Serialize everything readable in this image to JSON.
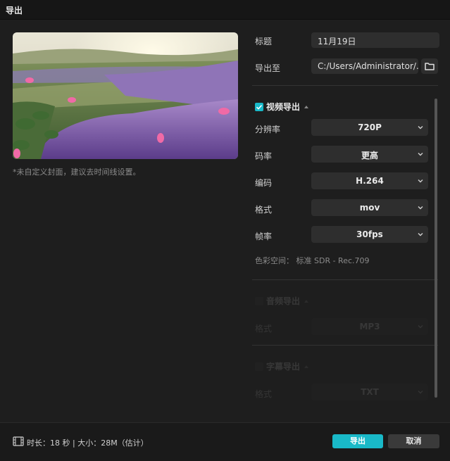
{
  "window": {
    "title": "导出"
  },
  "preview": {
    "cover_note": "*未自定义封面，建议去时间线设置。"
  },
  "form": {
    "title_label": "标题",
    "title_value": "11月19日",
    "export_to_label": "导出至",
    "export_to_value": "C:/Users/Administrator/..."
  },
  "video_export": {
    "label": "视频导出",
    "checked": true,
    "resolution_label": "分辨率",
    "resolution_value": "720P",
    "bitrate_label": "码率",
    "bitrate_value": "更高",
    "codec_label": "编码",
    "codec_value": "H.264",
    "format_label": "格式",
    "format_value": "mov",
    "framerate_label": "帧率",
    "framerate_value": "30fps",
    "colorspace": "色彩空间：  标准 SDR - Rec.709"
  },
  "audio_export": {
    "label": "音频导出",
    "checked": false,
    "format_label": "格式",
    "format_value": "MP3"
  },
  "subtitle_export": {
    "label": "字幕导出",
    "checked": false,
    "format_label": "格式",
    "format_value": "TXT"
  },
  "footer": {
    "stats": "时长：18 秒 | 大小：28M（估计）",
    "export_button": "导出",
    "cancel_button": "取消"
  },
  "colors": {
    "accent": "#19b9c8",
    "background": "#1e1e1e",
    "field": "#2e2e2e"
  },
  "icons": [
    "folder-icon",
    "check-icon",
    "chevron-down-icon",
    "caret-up-icon",
    "film-icon"
  ]
}
